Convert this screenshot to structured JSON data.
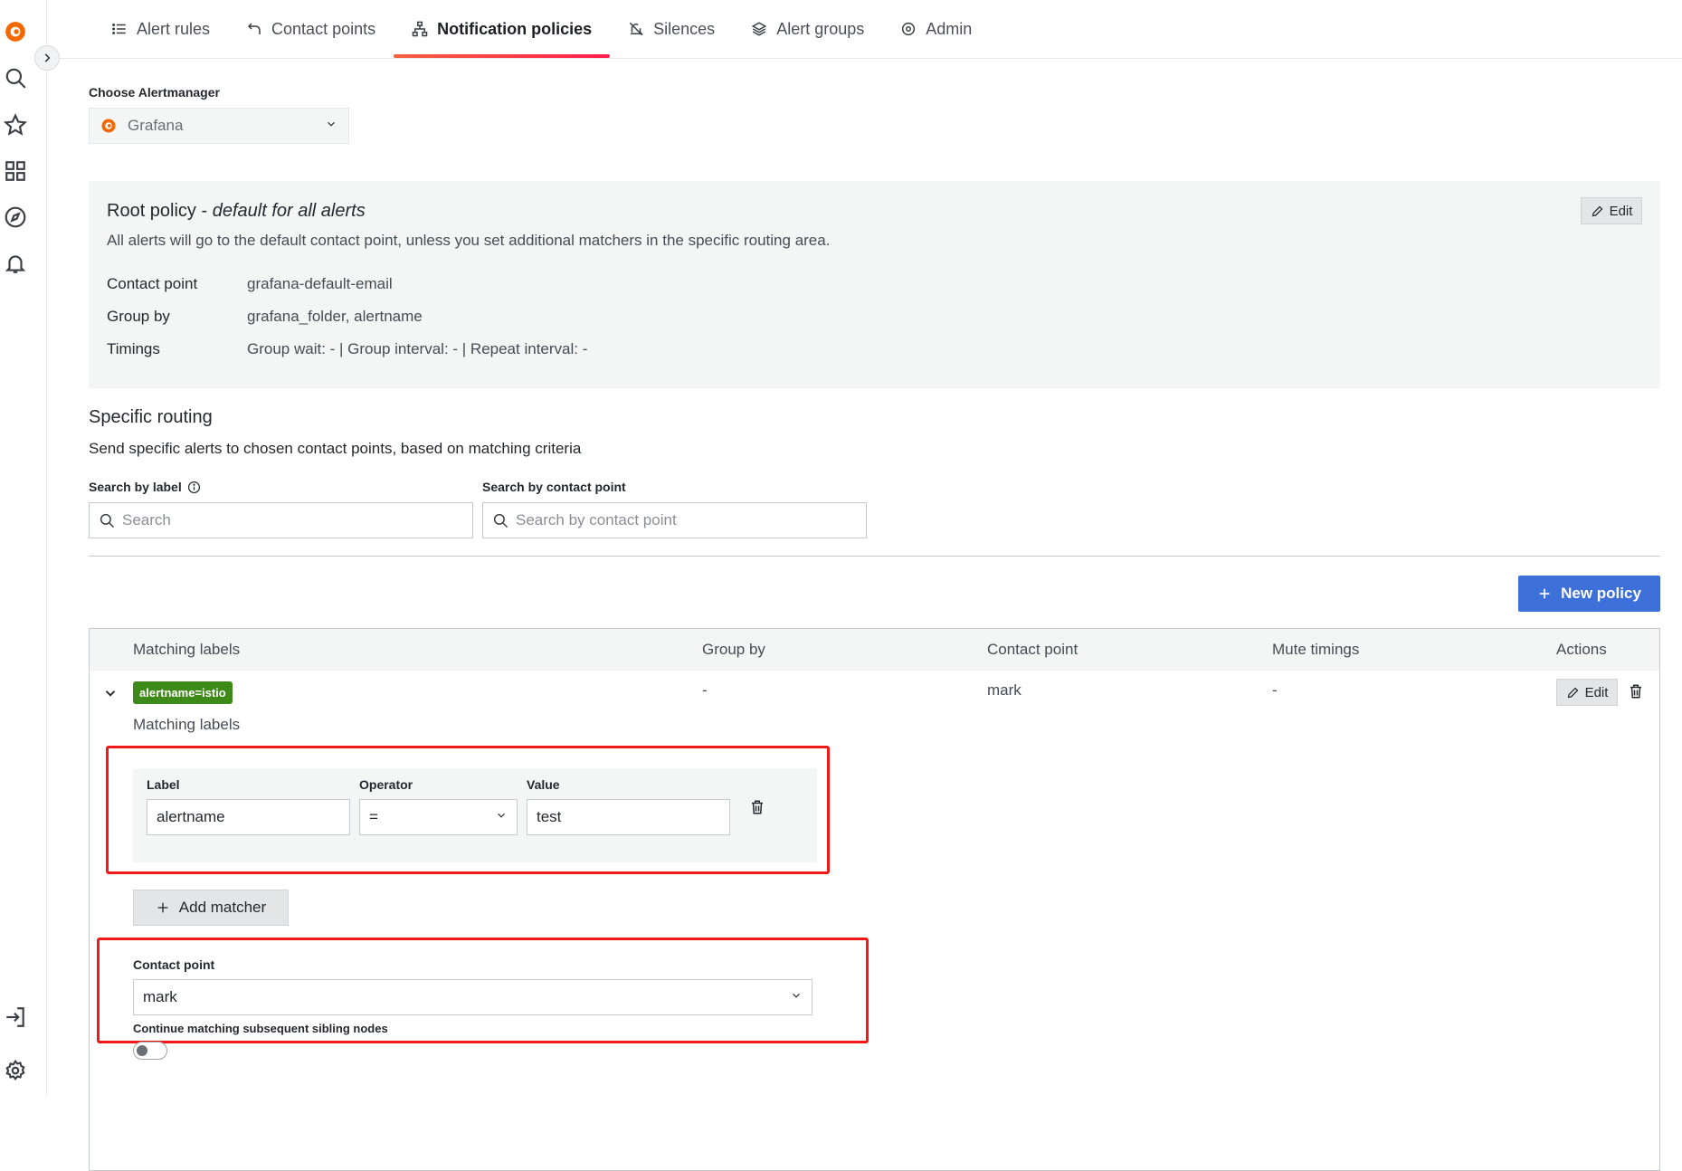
{
  "tabs": [
    {
      "label": "Alert rules",
      "icon": "list-icon"
    },
    {
      "label": "Contact points",
      "icon": "contact-icon"
    },
    {
      "label": "Notification policies",
      "icon": "sitemap-icon"
    },
    {
      "label": "Silences",
      "icon": "bell-slash-icon"
    },
    {
      "label": "Alert groups",
      "icon": "layers-icon"
    },
    {
      "label": "Admin",
      "icon": "cog-icon"
    }
  ],
  "alertmanager": {
    "label": "Choose Alertmanager",
    "value": "Grafana"
  },
  "root_policy": {
    "title": "Root policy - ",
    "title_em": "default for all alerts",
    "description": "All alerts will go to the default contact point, unless you set additional matchers in the specific routing area.",
    "edit_label": "Edit",
    "rows": [
      {
        "key": "Contact point",
        "value": "grafana-default-email"
      },
      {
        "key": "Group by",
        "value": "grafana_folder, alertname"
      },
      {
        "key": "Timings",
        "value": "Group wait: - | Group interval: - | Repeat interval: -"
      }
    ]
  },
  "specific_routing": {
    "title": "Specific routing",
    "description": "Send specific alerts to chosen contact points, based on matching criteria",
    "search_label": "Search by label",
    "search_placeholder": "Search",
    "contact_search_label": "Search by contact point",
    "contact_search_placeholder": "Search by contact point",
    "new_policy_label": "New policy"
  },
  "table": {
    "headers": [
      "Matching labels",
      "Group by",
      "Contact point",
      "Mute timings",
      "Actions"
    ],
    "row": {
      "badge": "alertname=istio",
      "group_by": "-",
      "contact_point": "mark",
      "mute_timings": "-",
      "edit_label": "Edit"
    }
  },
  "editor": {
    "matching_labels_title": "Matching labels",
    "label_header": "Label",
    "operator_header": "Operator",
    "value_header": "Value",
    "label_value": "alertname",
    "operator_value": "=",
    "value_value": "test",
    "add_matcher_label": "Add matcher",
    "contact_point_label": "Contact point",
    "contact_point_value": "mark",
    "continue_label": "Continue matching subsequent sibling nodes"
  }
}
